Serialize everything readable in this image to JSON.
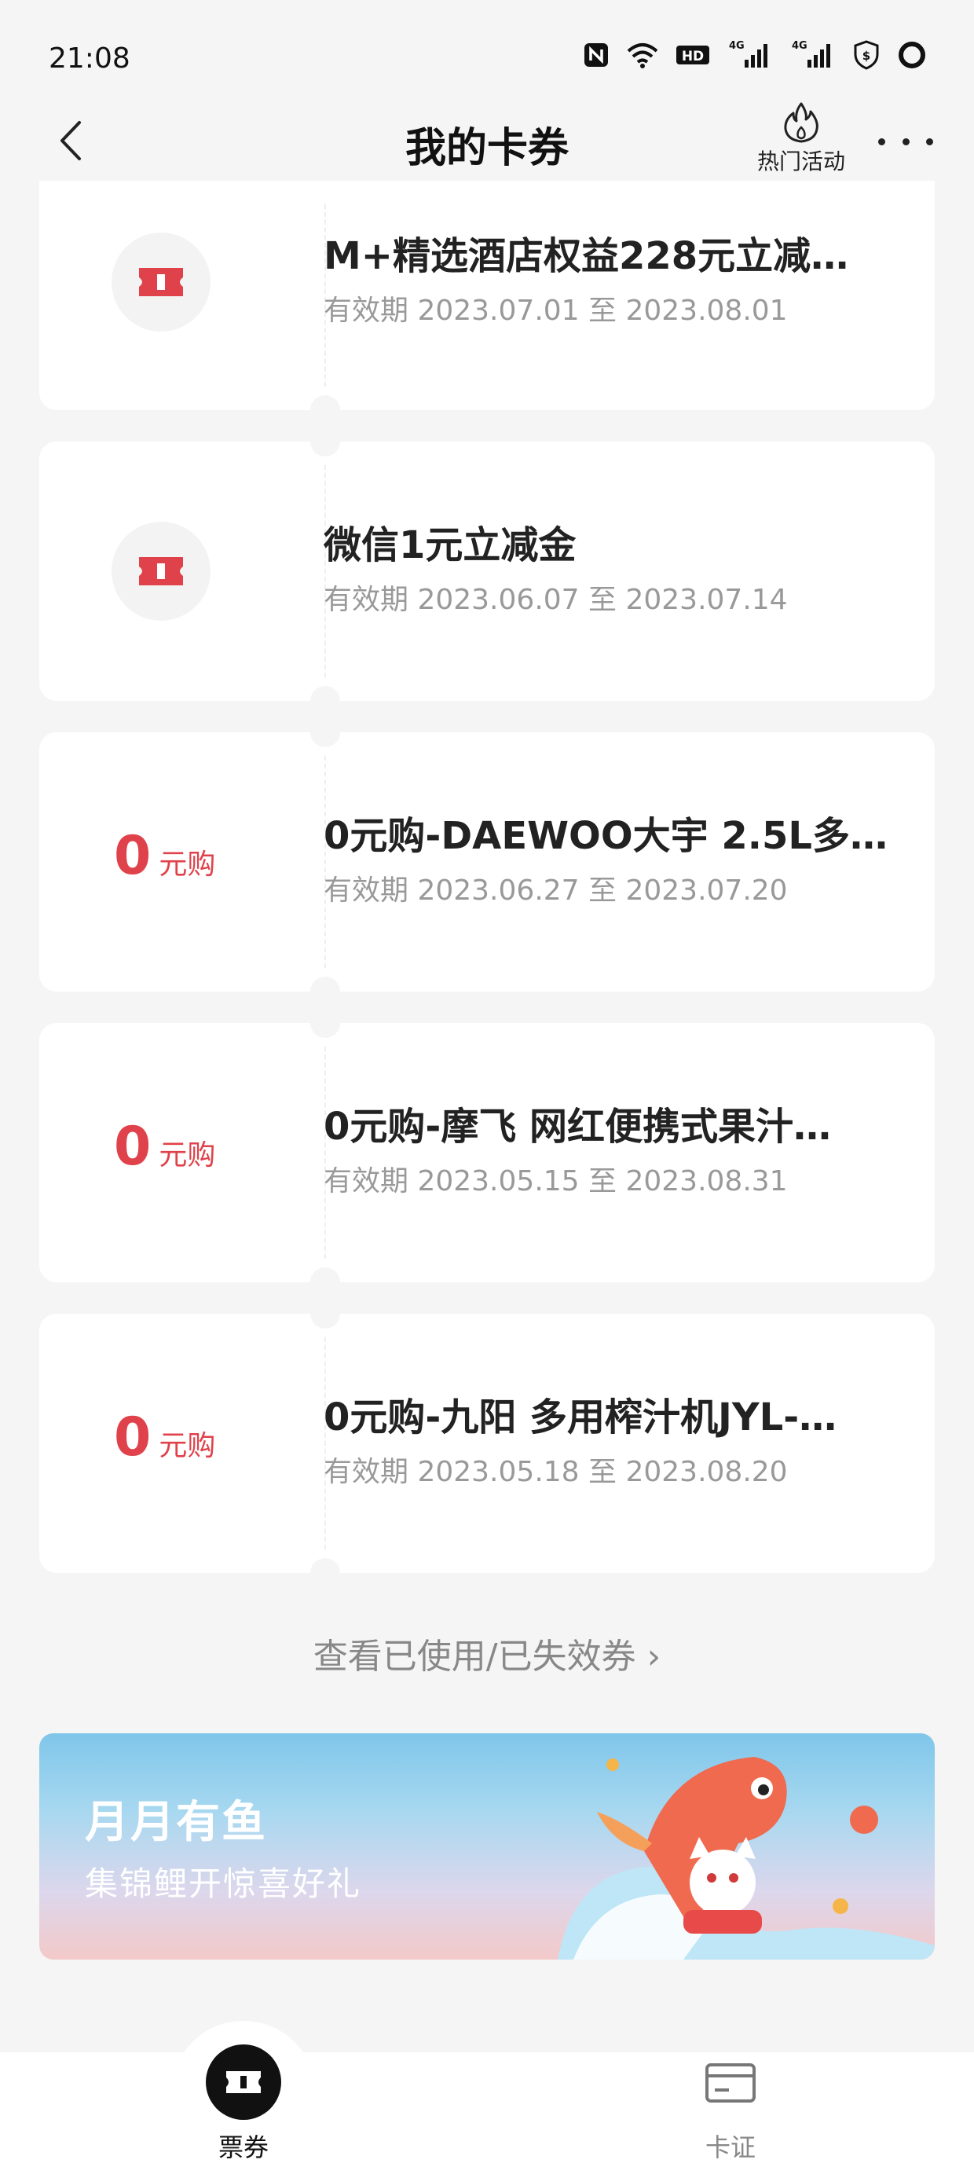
{
  "status_bar": {
    "time": "21:08",
    "icons": [
      "nfc-icon",
      "wifi-icon",
      "hd-icon",
      "signal-4g-1-icon",
      "signal-4g-2-icon",
      "shield-dollar-icon",
      "battery-ring-icon"
    ],
    "hd_label": "HD",
    "net_label": "4G"
  },
  "nav": {
    "title": "我的卡券",
    "hot_activity_label": "热门活动"
  },
  "coupons": [
    {
      "type": "ticket",
      "title": "M+精选酒店权益228元立减…",
      "validity": "有效期 2023.07.01 至 2023.08.01"
    },
    {
      "type": "ticket",
      "title": "微信1元立减金",
      "validity": "有效期 2023.06.07 至 2023.07.14"
    },
    {
      "type": "zero",
      "price": "0",
      "unit": "元购",
      "title": "0元购-DAEWOO大宇 2.5L多…",
      "validity": "有效期 2023.06.27 至 2023.07.20"
    },
    {
      "type": "zero",
      "price": "0",
      "unit": "元购",
      "title": "0元购-摩飞 网红便携式果汁…",
      "validity": "有效期 2023.05.15 至 2023.08.31"
    },
    {
      "type": "zero",
      "price": "0",
      "unit": "元购",
      "title": "0元购-九阳 多用榨汁机JYL-…",
      "validity": "有效期 2023.05.18 至 2023.08.20"
    }
  ],
  "view_used": {
    "label": "查看已使用/已失效券",
    "chevron": "›"
  },
  "banner": {
    "title": "月月有鱼",
    "subtitle": "集锦鲤开惊喜好礼"
  },
  "tabs": [
    {
      "label": "票券",
      "active": true
    },
    {
      "label": "卡证",
      "active": false
    }
  ],
  "colors": {
    "accent": "#e0424b",
    "background": "#f5f5f5"
  }
}
